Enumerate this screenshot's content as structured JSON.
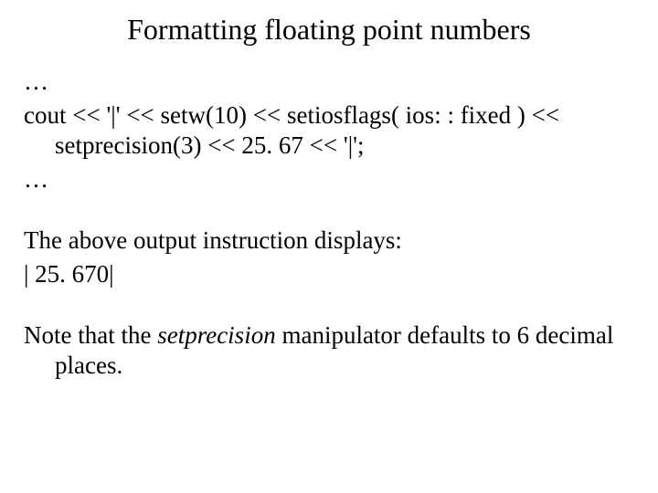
{
  "title": "Formatting floating point numbers",
  "code": {
    "l1": "…",
    "l2": "cout <<  '|' << setw(10) << setiosflags( ios: : fixed ) << setprecision(3) << 25. 67 << '|';",
    "l3": "…"
  },
  "explain": {
    "line1": "The above output instruction displays:",
    "output": "|    25. 670|"
  },
  "note": {
    "pre": "Note that the ",
    "em": "setprecision",
    "post": " manipulator defaults to 6 decimal places."
  }
}
